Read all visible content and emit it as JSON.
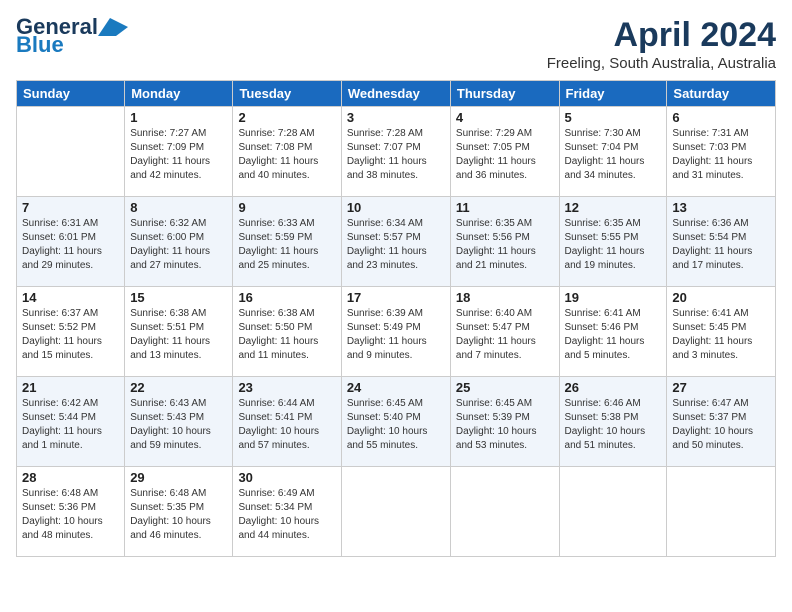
{
  "header": {
    "logo_line1": "General",
    "logo_line2": "Blue",
    "month_title": "April 2024",
    "subtitle": "Freeling, South Australia, Australia"
  },
  "columns": [
    "Sunday",
    "Monday",
    "Tuesday",
    "Wednesday",
    "Thursday",
    "Friday",
    "Saturday"
  ],
  "weeks": [
    [
      {
        "day": "",
        "info": ""
      },
      {
        "day": "1",
        "info": "Sunrise: 7:27 AM\nSunset: 7:09 PM\nDaylight: 11 hours\nand 42 minutes."
      },
      {
        "day": "2",
        "info": "Sunrise: 7:28 AM\nSunset: 7:08 PM\nDaylight: 11 hours\nand 40 minutes."
      },
      {
        "day": "3",
        "info": "Sunrise: 7:28 AM\nSunset: 7:07 PM\nDaylight: 11 hours\nand 38 minutes."
      },
      {
        "day": "4",
        "info": "Sunrise: 7:29 AM\nSunset: 7:05 PM\nDaylight: 11 hours\nand 36 minutes."
      },
      {
        "day": "5",
        "info": "Sunrise: 7:30 AM\nSunset: 7:04 PM\nDaylight: 11 hours\nand 34 minutes."
      },
      {
        "day": "6",
        "info": "Sunrise: 7:31 AM\nSunset: 7:03 PM\nDaylight: 11 hours\nand 31 minutes."
      }
    ],
    [
      {
        "day": "7",
        "info": "Sunrise: 6:31 AM\nSunset: 6:01 PM\nDaylight: 11 hours\nand 29 minutes."
      },
      {
        "day": "8",
        "info": "Sunrise: 6:32 AM\nSunset: 6:00 PM\nDaylight: 11 hours\nand 27 minutes."
      },
      {
        "day": "9",
        "info": "Sunrise: 6:33 AM\nSunset: 5:59 PM\nDaylight: 11 hours\nand 25 minutes."
      },
      {
        "day": "10",
        "info": "Sunrise: 6:34 AM\nSunset: 5:57 PM\nDaylight: 11 hours\nand 23 minutes."
      },
      {
        "day": "11",
        "info": "Sunrise: 6:35 AM\nSunset: 5:56 PM\nDaylight: 11 hours\nand 21 minutes."
      },
      {
        "day": "12",
        "info": "Sunrise: 6:35 AM\nSunset: 5:55 PM\nDaylight: 11 hours\nand 19 minutes."
      },
      {
        "day": "13",
        "info": "Sunrise: 6:36 AM\nSunset: 5:54 PM\nDaylight: 11 hours\nand 17 minutes."
      }
    ],
    [
      {
        "day": "14",
        "info": "Sunrise: 6:37 AM\nSunset: 5:52 PM\nDaylight: 11 hours\nand 15 minutes."
      },
      {
        "day": "15",
        "info": "Sunrise: 6:38 AM\nSunset: 5:51 PM\nDaylight: 11 hours\nand 13 minutes."
      },
      {
        "day": "16",
        "info": "Sunrise: 6:38 AM\nSunset: 5:50 PM\nDaylight: 11 hours\nand 11 minutes."
      },
      {
        "day": "17",
        "info": "Sunrise: 6:39 AM\nSunset: 5:49 PM\nDaylight: 11 hours\nand 9 minutes."
      },
      {
        "day": "18",
        "info": "Sunrise: 6:40 AM\nSunset: 5:47 PM\nDaylight: 11 hours\nand 7 minutes."
      },
      {
        "day": "19",
        "info": "Sunrise: 6:41 AM\nSunset: 5:46 PM\nDaylight: 11 hours\nand 5 minutes."
      },
      {
        "day": "20",
        "info": "Sunrise: 6:41 AM\nSunset: 5:45 PM\nDaylight: 11 hours\nand 3 minutes."
      }
    ],
    [
      {
        "day": "21",
        "info": "Sunrise: 6:42 AM\nSunset: 5:44 PM\nDaylight: 11 hours\nand 1 minute."
      },
      {
        "day": "22",
        "info": "Sunrise: 6:43 AM\nSunset: 5:43 PM\nDaylight: 10 hours\nand 59 minutes."
      },
      {
        "day": "23",
        "info": "Sunrise: 6:44 AM\nSunset: 5:41 PM\nDaylight: 10 hours\nand 57 minutes."
      },
      {
        "day": "24",
        "info": "Sunrise: 6:45 AM\nSunset: 5:40 PM\nDaylight: 10 hours\nand 55 minutes."
      },
      {
        "day": "25",
        "info": "Sunrise: 6:45 AM\nSunset: 5:39 PM\nDaylight: 10 hours\nand 53 minutes."
      },
      {
        "day": "26",
        "info": "Sunrise: 6:46 AM\nSunset: 5:38 PM\nDaylight: 10 hours\nand 51 minutes."
      },
      {
        "day": "27",
        "info": "Sunrise: 6:47 AM\nSunset: 5:37 PM\nDaylight: 10 hours\nand 50 minutes."
      }
    ],
    [
      {
        "day": "28",
        "info": "Sunrise: 6:48 AM\nSunset: 5:36 PM\nDaylight: 10 hours\nand 48 minutes."
      },
      {
        "day": "29",
        "info": "Sunrise: 6:48 AM\nSunset: 5:35 PM\nDaylight: 10 hours\nand 46 minutes."
      },
      {
        "day": "30",
        "info": "Sunrise: 6:49 AM\nSunset: 5:34 PM\nDaylight: 10 hours\nand 44 minutes."
      },
      {
        "day": "",
        "info": ""
      },
      {
        "day": "",
        "info": ""
      },
      {
        "day": "",
        "info": ""
      },
      {
        "day": "",
        "info": ""
      }
    ]
  ]
}
